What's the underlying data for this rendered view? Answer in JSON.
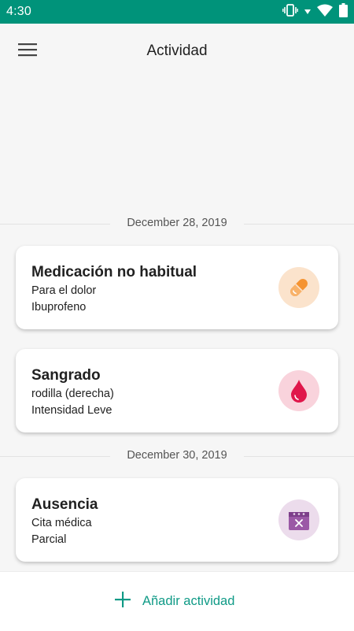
{
  "status_bar": {
    "time": "4:30"
  },
  "header": {
    "title": "Actividad"
  },
  "groups": [
    {
      "date": "December 28, 2019",
      "cards": [
        {
          "title": "Medicación no habitual",
          "line1": "Para el dolor",
          "line2": "Ibuprofeno",
          "icon": "pill-icon",
          "badge_color": "#fbe3cc",
          "icon_color": "#f59331"
        },
        {
          "title": "Sangrado",
          "line1": "rodilla (derecha)",
          "line2": "Intensidad Leve",
          "icon": "blood-drop-icon",
          "badge_color": "#f9d3dc",
          "icon_color": "#e0174b"
        }
      ]
    },
    {
      "date": "December 30, 2019",
      "cards": [
        {
          "title": "Ausencia",
          "line1": "Cita médica",
          "line2": "Parcial",
          "icon": "calendar-cancel-icon",
          "badge_color": "#ecdcec",
          "icon_color": "#9b59a6"
        }
      ]
    }
  ],
  "footer": {
    "add_label": "Añadir actividad",
    "accent": "#0f9a86"
  }
}
